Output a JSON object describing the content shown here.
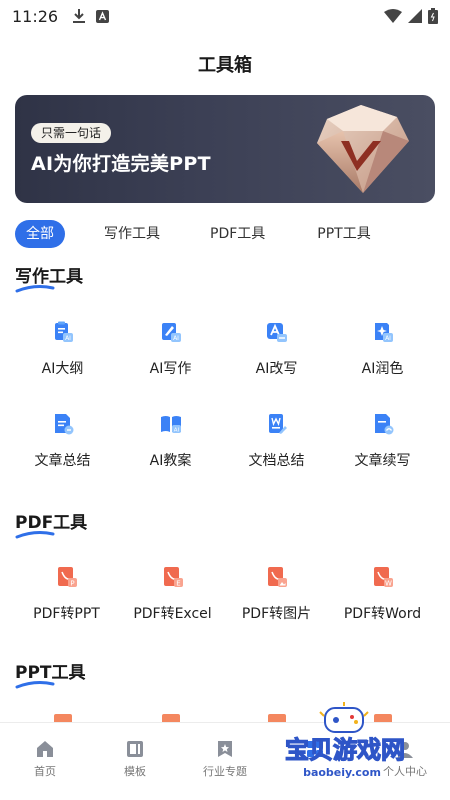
{
  "status_bar": {
    "time": "11:26"
  },
  "header": {
    "title": "工具箱"
  },
  "banner": {
    "chip": "只需一句话",
    "headline": "AI为你打造完美PPT"
  },
  "tabs": [
    {
      "label": "全部",
      "active": true
    },
    {
      "label": "写作工具",
      "active": false
    },
    {
      "label": "PDF工具",
      "active": false
    },
    {
      "label": "PPT工具",
      "active": false
    }
  ],
  "sections": {
    "writing": {
      "title": "写作工具",
      "tools": [
        {
          "label": "AI大纲",
          "icon": "ai-outline-icon"
        },
        {
          "label": "AI写作",
          "icon": "ai-writing-icon"
        },
        {
          "label": "AI改写",
          "icon": "ai-rewrite-icon"
        },
        {
          "label": "AI润色",
          "icon": "ai-polish-icon"
        },
        {
          "label": "文章总结",
          "icon": "article-summary-icon"
        },
        {
          "label": "AI教案",
          "icon": "ai-lesson-plan-icon"
        },
        {
          "label": "文档总结",
          "icon": "doc-summary-icon"
        },
        {
          "label": "文章续写",
          "icon": "article-continue-icon"
        }
      ]
    },
    "pdf": {
      "title": "PDF工具",
      "tools": [
        {
          "label": "PDF转PPT",
          "icon": "pdf-to-ppt-icon"
        },
        {
          "label": "PDF转Excel",
          "icon": "pdf-to-excel-icon"
        },
        {
          "label": "PDF转图片",
          "icon": "pdf-to-image-icon"
        },
        {
          "label": "PDF转Word",
          "icon": "pdf-to-word-icon"
        }
      ]
    },
    "ppt": {
      "title": "PPT工具"
    }
  },
  "bottom_nav": [
    {
      "label": "首页",
      "icon": "home-icon"
    },
    {
      "label": "模板",
      "icon": "template-icon"
    },
    {
      "label": "行业专题",
      "icon": "industry-topic-icon"
    },
    {
      "label": "",
      "icon": "tools-icon"
    },
    {
      "label": "个人中心",
      "icon": "profile-icon"
    }
  ],
  "watermark": {
    "text": "宝贝游戏网",
    "url": "baobeiy.com"
  },
  "colors": {
    "accent": "#2f6fe8",
    "writing_icon": "#3b82f6",
    "pdf_icon": "#f06a4f"
  }
}
